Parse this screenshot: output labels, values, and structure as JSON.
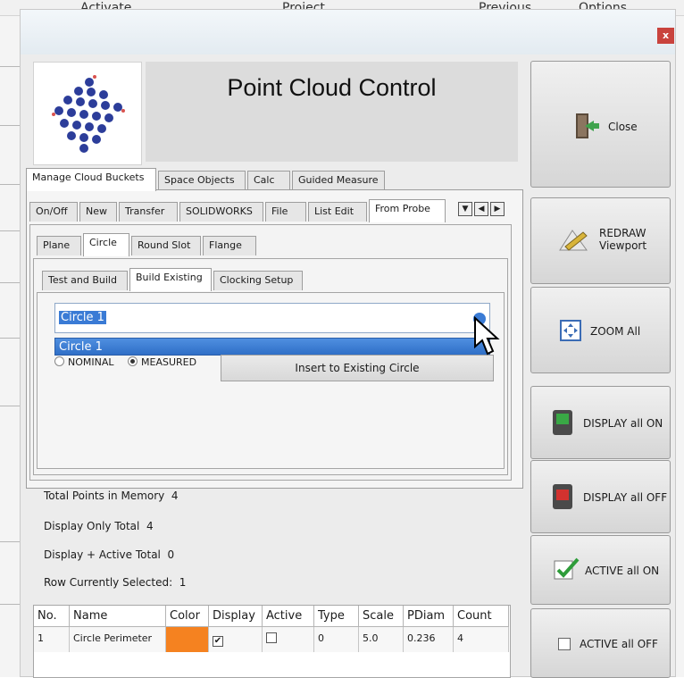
{
  "background_menu": [
    "Activate",
    "Project",
    "Previous",
    "Options"
  ],
  "title_bar": {
    "close_glyph": "x"
  },
  "header": {
    "title": "Point Cloud Control"
  },
  "main_tabs": [
    "Manage Cloud Buckets",
    "Space Objects",
    "Calc",
    "Guided Measure"
  ],
  "sub_tabs": [
    "On/Off",
    "New",
    "Transfer",
    "SOLIDWORKS",
    "File",
    "List Edit",
    "From Probe"
  ],
  "tab_arrows": [
    "▼",
    "◀",
    "▶"
  ],
  "feature_tabs": [
    "Plane",
    "Circle",
    "Round Slot",
    "Flange"
  ],
  "build_tabs": [
    "Test and Build",
    "Build Existing",
    "Clocking Setup"
  ],
  "combo": {
    "value": "Circle 1",
    "dropdown_items": [
      "Circle 1"
    ]
  },
  "radios": [
    {
      "label": "NOMINAL",
      "selected": false
    },
    {
      "label": "MEASURED",
      "selected": true
    }
  ],
  "insert_button": "Insert to Existing Circle",
  "stats": {
    "total_points": {
      "label": "Total Points in Memory",
      "value": "4"
    },
    "display_only": {
      "label": "Display Only Total",
      "value": "4"
    },
    "display_active": {
      "label": "Display + Active Total",
      "value": "0"
    },
    "row_selected": {
      "label": "Row Currently Selected:",
      "value": "1"
    }
  },
  "table": {
    "headers": [
      "No.",
      "Name",
      "Color",
      "Display",
      "Active",
      "Type",
      "Scale",
      "PDiam",
      "Count"
    ],
    "rows": [
      {
        "no": "1",
        "name": "Circle Perimeter",
        "color": "#f58220",
        "display": true,
        "active": false,
        "type": "0",
        "scale": "5.0",
        "pdiam": "0.236",
        "count": "4"
      }
    ]
  },
  "right_buttons": {
    "close": "Close",
    "redraw_1": "REDRAW",
    "redraw_2": "Viewport",
    "zoom": "ZOOM All",
    "display_on": "DISPLAY all ON",
    "display_off": "DISPLAY all OFF",
    "active_on": "ACTIVE all ON",
    "active_off": "ACTIVE all OFF"
  },
  "colors": {
    "selection_blue": "#3a7bd5",
    "orange": "#f58220",
    "close_red": "#c9433d"
  }
}
